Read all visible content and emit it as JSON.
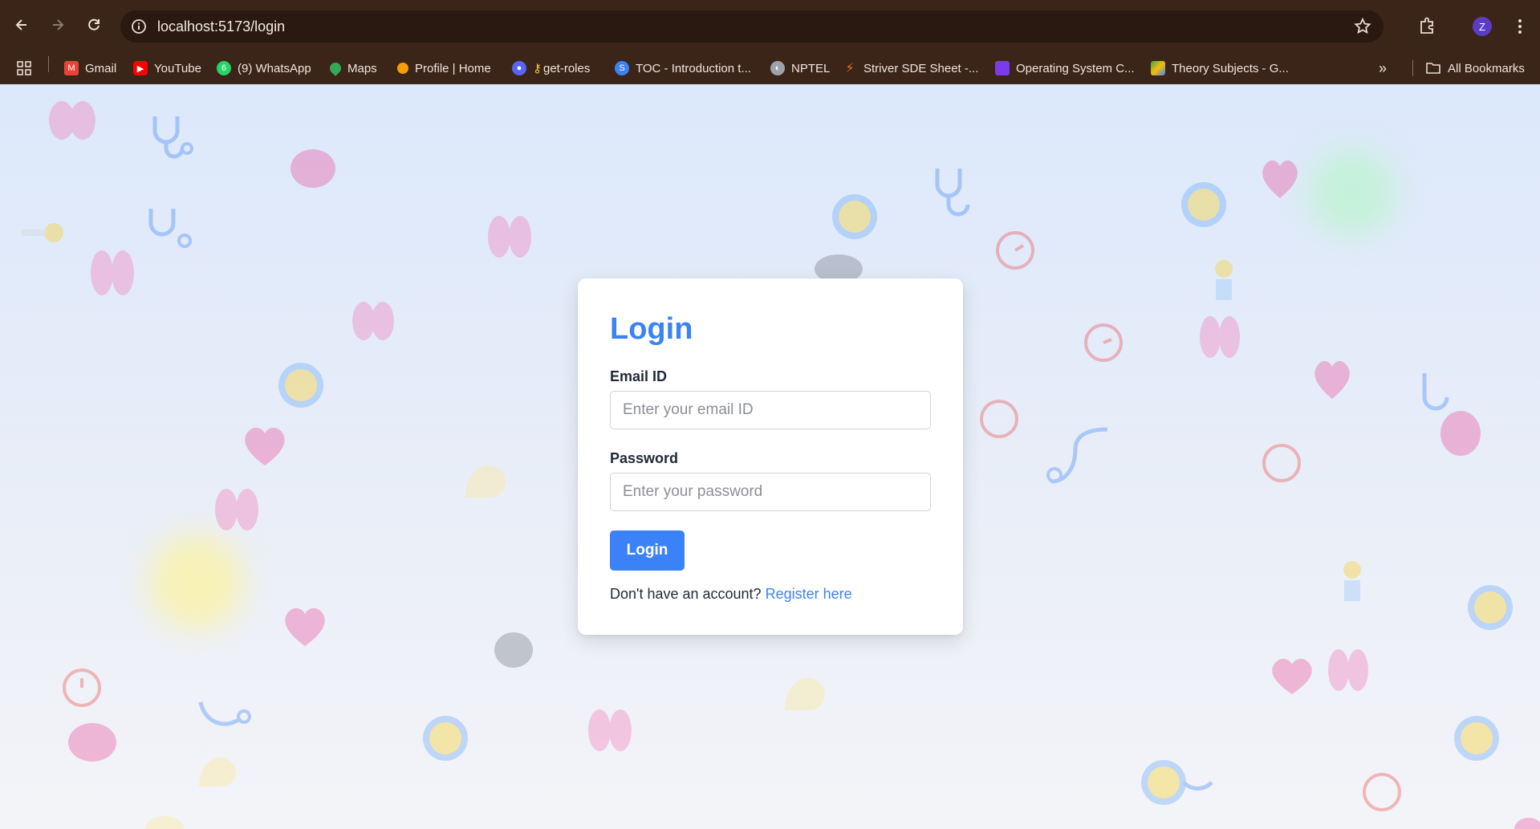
{
  "browser": {
    "url": "localhost:5173/login",
    "profile_initial": "Z",
    "bookmarks": [
      {
        "label": "Gmail",
        "icon": "gmail-icon",
        "color": "#ea4335"
      },
      {
        "label": "YouTube",
        "icon": "youtube-icon",
        "color": "#ff0000"
      },
      {
        "label": "(9) WhatsApp",
        "icon": "whatsapp-icon",
        "color": "#25d366",
        "badge": "6"
      },
      {
        "label": "Maps",
        "icon": "maps-icon",
        "color": "#34a853"
      },
      {
        "label": "Profile | Home",
        "icon": "profile-icon",
        "color": "#f59e0b"
      },
      {
        "label": "get-roles",
        "icon": "discord-icon",
        "color": "#5865f2"
      },
      {
        "label": "TOC - Introduction t...",
        "icon": "toc-icon",
        "color": "#3b82f6"
      },
      {
        "label": "NPTEL",
        "icon": "globe-icon",
        "color": "#9ca3af"
      },
      {
        "label": "Striver SDE Sheet -...",
        "icon": "striver-icon",
        "color": "#f97316"
      },
      {
        "label": "Operating System C...",
        "icon": "os-icon",
        "color": "#7c3aed"
      },
      {
        "label": "Theory Subjects - G...",
        "icon": "drive-icon",
        "color": "#fbbc04"
      }
    ],
    "all_bookmarks_label": "All Bookmarks"
  },
  "login": {
    "title": "Login",
    "email_label": "Email ID",
    "email_value": "",
    "email_placeholder": "Enter your email ID",
    "password_label": "Password",
    "password_value": "",
    "password_placeholder": "Enter your password",
    "submit_label": "Login",
    "register_prompt": "Don't have an account?",
    "register_link": "Register here"
  },
  "colors": {
    "accent": "#3b82f6",
    "chrome_bg": "#3b2418"
  }
}
